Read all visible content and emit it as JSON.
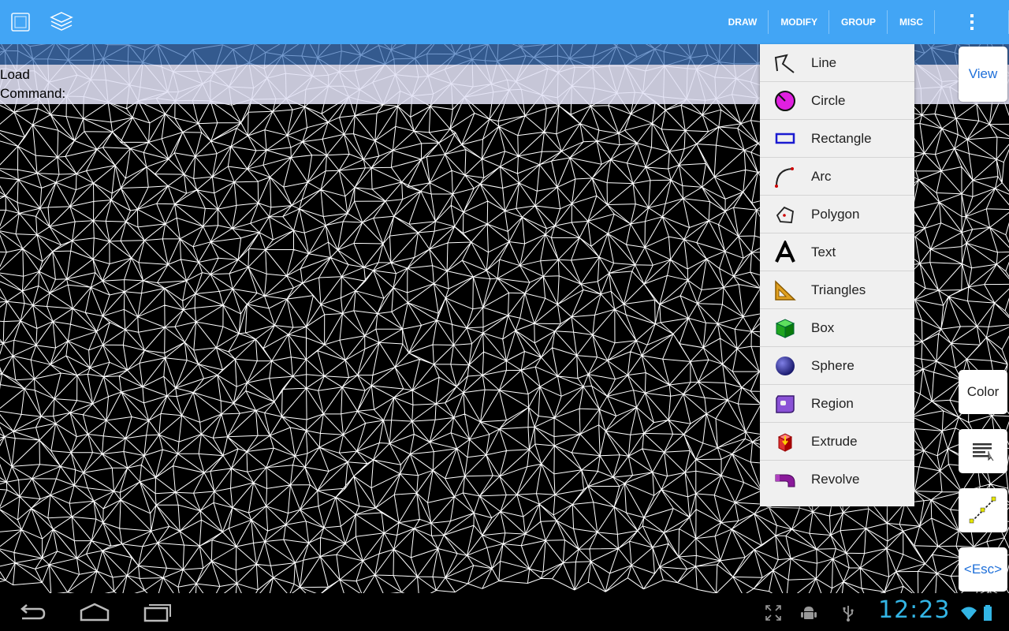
{
  "toolbar": {
    "menus": [
      "DRAW",
      "MODIFY",
      "GROUP",
      "MISC"
    ],
    "icons": [
      "window-icon",
      "layers-icon",
      "overflow-menu-icon"
    ],
    "accent_color": "#42a5f5"
  },
  "command_area": {
    "line1": "Load",
    "line2": "Command:"
  },
  "draw_menu": {
    "items": [
      {
        "label": "Line",
        "icon": "line-icon"
      },
      {
        "label": "Circle",
        "icon": "circle-icon"
      },
      {
        "label": "Rectangle",
        "icon": "rectangle-icon"
      },
      {
        "label": "Arc",
        "icon": "arc-icon"
      },
      {
        "label": "Polygon",
        "icon": "polygon-icon"
      },
      {
        "label": "Text",
        "icon": "text-icon"
      },
      {
        "label": "Triangles",
        "icon": "triangles-icon"
      },
      {
        "label": "Box",
        "icon": "box-icon"
      },
      {
        "label": "Sphere",
        "icon": "sphere-icon"
      },
      {
        "label": "Region",
        "icon": "region-icon"
      },
      {
        "label": "Extrude",
        "icon": "extrude-icon"
      },
      {
        "label": "Revolve",
        "icon": "revolve-icon"
      }
    ]
  },
  "side_buttons": {
    "view": "View",
    "color": "Color",
    "esc": "<Esc>",
    "text_color": "#1e6fd9"
  },
  "status_bar": {
    "time": "12:23",
    "icons": [
      "back-icon",
      "home-icon",
      "recent-apps-icon",
      "fullscreen-icon",
      "android-debug-icon",
      "usb-icon",
      "wifi-icon",
      "battery-icon"
    ]
  }
}
